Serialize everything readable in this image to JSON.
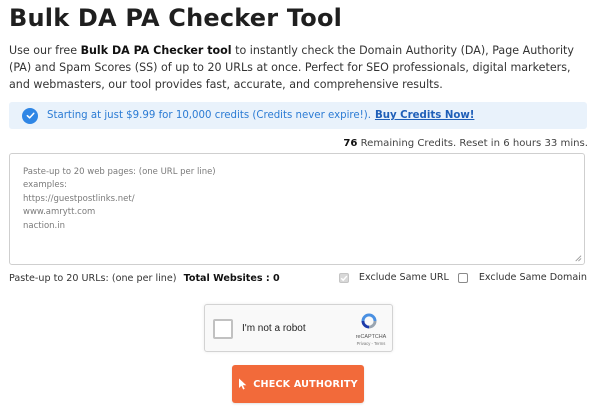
{
  "page": {
    "title": "Bulk DA PA Checker Tool",
    "intro": {
      "part1": "Use our free ",
      "bold": "Bulk DA PA Checker tool",
      "part2": " to instantly check the Domain Authority (DA), Page Authority (PA) and Spam Scores (SS) of up to 20 URLs at once. Perfect for SEO professionals, digital marketers, and webmasters, our tool provides fast, accurate, and comprehensive results."
    }
  },
  "promo": {
    "text": "Starting at just $9.99 for 10,000 credits (Credits never expire!).",
    "link_label": "Buy Credits Now!",
    "icon": "check-circle-icon"
  },
  "credits": {
    "count": "76",
    "text": " Remaining Credits. Reset in 6 hours 33 mins."
  },
  "url_input": {
    "placeholder": "Paste-up to 20 web pages: (one URL per line)\nexamples:\nhttps://guestpostlinks.net/\nwww.amrytt.com\nnaction.in",
    "value": ""
  },
  "meta": {
    "hint": "Paste-up to 20 URLs: (one per line)",
    "total_label": "Total Websites : 0",
    "exclude_url_label": "Exclude Same URL",
    "exclude_url_checked": true,
    "exclude_domain_label": "Exclude Same Domain",
    "exclude_domain_checked": false
  },
  "recaptcha": {
    "label": "I'm not a robot",
    "brand": "reCAPTCHA",
    "legal": "Privacy - Terms"
  },
  "cta": {
    "label": "CHECK AUTHORITY",
    "icon": "cursor-pointer-icon"
  },
  "colors": {
    "accent": "#f26a3a",
    "promo_bg": "#e9f2fb",
    "promo_text": "#2b7bd4",
    "link": "#1f5fb8"
  }
}
